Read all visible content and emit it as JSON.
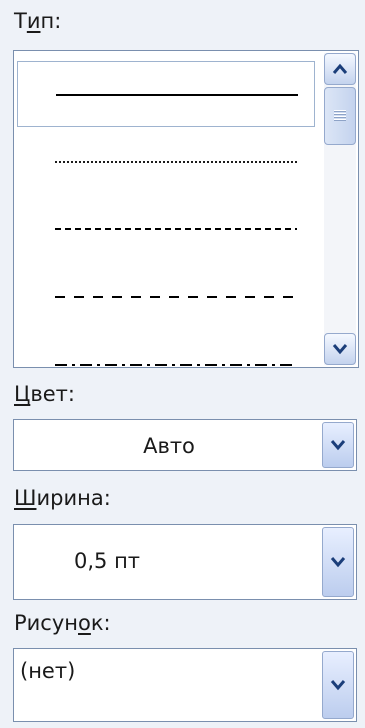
{
  "type_label": "Тип:",
  "type_label_pre": "Т",
  "type_label_accel": "и",
  "type_label_post": "п:",
  "line_styles": [
    "solid",
    "dotted",
    "dashed",
    "long-dash",
    "dash-dot"
  ],
  "color": {
    "label_accel": "Ц",
    "label_rest": "вет:",
    "value": "Авто"
  },
  "width": {
    "label_accel": "Ш",
    "label_rest": "ирина:",
    "value": "0,5 пт"
  },
  "pattern": {
    "label_pre": "Рисун",
    "label_accel": "о",
    "label_post": "к:",
    "value": "(нет)"
  }
}
